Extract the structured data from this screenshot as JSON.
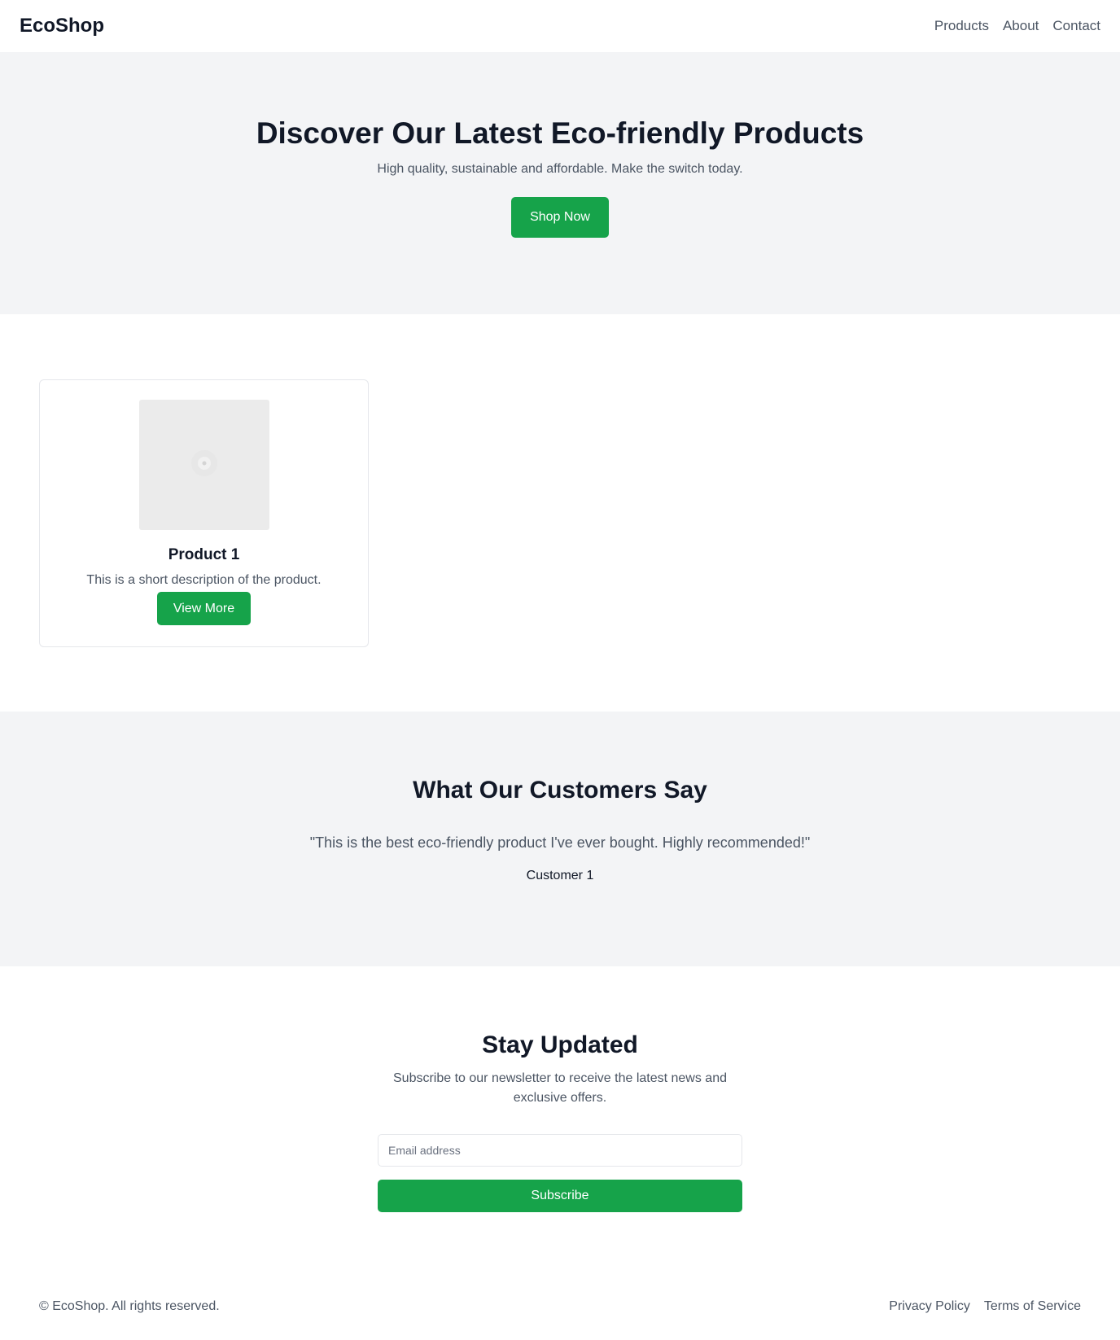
{
  "header": {
    "brand": "EcoShop",
    "nav": [
      "Products",
      "About",
      "Contact"
    ]
  },
  "hero": {
    "title": "Discover Our Latest Eco-friendly Products",
    "subtitle": "High quality, sustainable and affordable. Make the switch today.",
    "cta_label": "Shop Now"
  },
  "products": [
    {
      "title": "Product 1",
      "description": "This is a short description of the product.",
      "button_label": "View More",
      "image_icon": "image-placeholder-icon"
    }
  ],
  "testimonials": {
    "title": "What Our Customers Say",
    "quote": "\"This is the best eco-friendly product I've ever bought. Highly recommended!\"",
    "author": "Customer 1"
  },
  "newsletter": {
    "title": "Stay Updated",
    "text": "Subscribe to our newsletter to receive the latest news and exclusive offers.",
    "email_placeholder": "Email address",
    "email_value": "",
    "subscribe_label": "Subscribe"
  },
  "footer": {
    "copyright": "© EcoShop. All rights reserved.",
    "links": [
      "Privacy Policy",
      "Terms of Service"
    ]
  },
  "colors": {
    "accent": "#16a34a",
    "section_bg": "#f3f4f6",
    "text_dark": "#111827",
    "text_muted": "#4b5563"
  }
}
